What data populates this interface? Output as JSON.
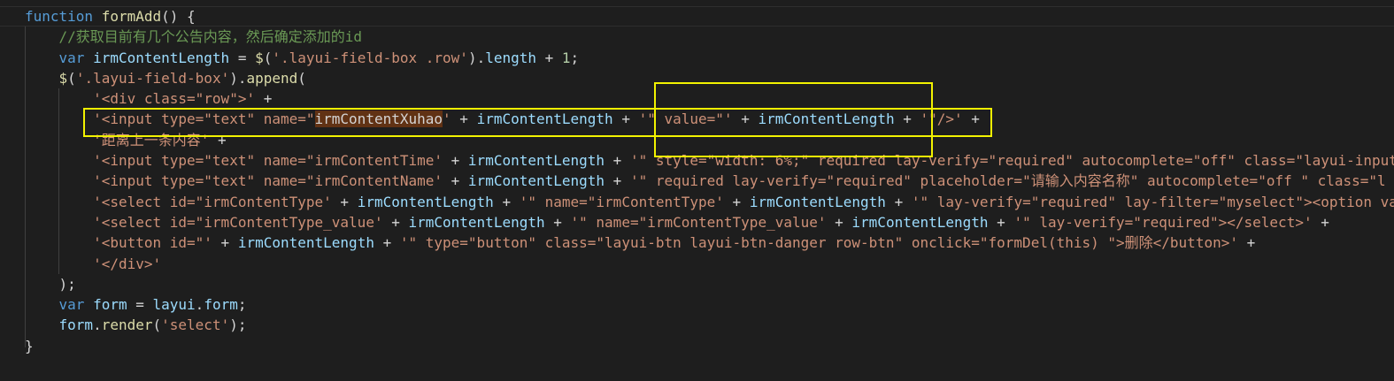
{
  "highlight_color": "#f2f200",
  "lines": [
    [
      [
        "kw",
        "function "
      ],
      [
        "fn",
        "formAdd"
      ],
      [
        "pun",
        "() {"
      ]
    ],
    [
      [
        "cmt",
        "//获取目前有几个公告内容，然后确定添加的id"
      ]
    ],
    [
      [
        "kw",
        "var "
      ],
      [
        "var",
        "irmContentLength"
      ],
      [
        "pun",
        " = "
      ],
      [
        "fn",
        "$"
      ],
      [
        "pun",
        "("
      ],
      [
        "str",
        "'.layui-field-box .row'"
      ],
      [
        "pun",
        ")."
      ],
      [
        "var",
        "length"
      ],
      [
        "pun",
        " + "
      ],
      [
        "num",
        "1"
      ],
      [
        "pun",
        ";"
      ]
    ],
    [
      [
        "fn",
        "$"
      ],
      [
        "pun",
        "("
      ],
      [
        "str",
        "'.layui-field-box'"
      ],
      [
        "pun",
        ")."
      ],
      [
        "fn",
        "append"
      ],
      [
        "pun",
        "("
      ]
    ],
    [
      [
        "str",
        "'<div class=\"row\">'"
      ],
      [
        "pun",
        " +"
      ]
    ],
    [
      [
        "str",
        "'<input type=\"text\" name=\""
      ],
      [
        "hl",
        "irmContentXuhao"
      ],
      [
        "str",
        "'"
      ],
      [
        "pun",
        " + "
      ],
      [
        "var",
        "irmContentLength"
      ],
      [
        "pun",
        " + "
      ],
      [
        "str",
        "'\" value=\"'"
      ],
      [
        "pun",
        " + "
      ],
      [
        "var",
        "irmContentLength"
      ],
      [
        "pun",
        " + "
      ],
      [
        "str",
        "'\"/>'"
      ],
      [
        "pun",
        " +"
      ]
    ],
    [
      [
        "str",
        "'距离上一条内容'"
      ],
      [
        "pun",
        " +"
      ]
    ],
    [
      [
        "str",
        "'<input type=\"text\" name=\"irmContentTime'"
      ],
      [
        "pun",
        " + "
      ],
      [
        "var",
        "irmContentLength"
      ],
      [
        "pun",
        " + "
      ],
      [
        "str",
        "'\" style=\"width: 6%;\" required lay-verify=\"required\" autocomplete=\"off\" class=\"layui-input"
      ]
    ],
    [
      [
        "str",
        "'<input type=\"text\" name=\"irmContentName'"
      ],
      [
        "pun",
        " + "
      ],
      [
        "var",
        "irmContentLength"
      ],
      [
        "pun",
        " + "
      ],
      [
        "str",
        "'\" required lay-verify=\"required\" placeholder=\"请输入内容名称\" autocomplete=\"off \" class=\"l"
      ]
    ],
    [
      [
        "str",
        "'<select id=\"irmContentType'"
      ],
      [
        "pun",
        " + "
      ],
      [
        "var",
        "irmContentLength"
      ],
      [
        "pun",
        " + "
      ],
      [
        "str",
        "'\" name=\"irmContentType'"
      ],
      [
        "pun",
        " + "
      ],
      [
        "var",
        "irmContentLength"
      ],
      [
        "pun",
        " + "
      ],
      [
        "str",
        "'\" lay-verify=\"required\" lay-filter=\"myselect\"><option va"
      ]
    ],
    [
      [
        "str",
        "'<select id=\"irmContentType_value'"
      ],
      [
        "pun",
        " + "
      ],
      [
        "var",
        "irmContentLength"
      ],
      [
        "pun",
        " + "
      ],
      [
        "str",
        "'\" name=\"irmContentType_value'"
      ],
      [
        "pun",
        " + "
      ],
      [
        "var",
        "irmContentLength"
      ],
      [
        "pun",
        " + "
      ],
      [
        "str",
        "'\" lay-verify=\"required\"></select>'"
      ],
      [
        "pun",
        " +"
      ]
    ],
    [
      [
        "str",
        "'<button id=\"'"
      ],
      [
        "pun",
        " + "
      ],
      [
        "var",
        "irmContentLength"
      ],
      [
        "pun",
        " + "
      ],
      [
        "str",
        "'\" type=\"button\" class=\"layui-btn layui-btn-danger row-btn\" onclick=\"formDel(this) \">删除</button>'"
      ],
      [
        "pun",
        " +"
      ]
    ],
    [
      [
        "str",
        "'</div>'"
      ]
    ],
    [
      [
        "pun",
        ");"
      ]
    ],
    [
      [
        "kw",
        "var "
      ],
      [
        "var",
        "form"
      ],
      [
        "pun",
        " = "
      ],
      [
        "var",
        "layui"
      ],
      [
        "pun",
        "."
      ],
      [
        "var",
        "form"
      ],
      [
        "pun",
        ";"
      ]
    ],
    [
      [
        "var",
        "form"
      ],
      [
        "pun",
        "."
      ],
      [
        "fn",
        "render"
      ],
      [
        "pun",
        "("
      ],
      [
        "str",
        "'select'"
      ],
      [
        "pun",
        ");"
      ]
    ],
    [
      [
        "pun",
        "}"
      ]
    ]
  ],
  "indents": [
    0,
    2,
    2,
    2,
    4,
    4,
    4,
    4,
    4,
    4,
    4,
    4,
    4,
    2,
    2,
    2,
    0
  ]
}
